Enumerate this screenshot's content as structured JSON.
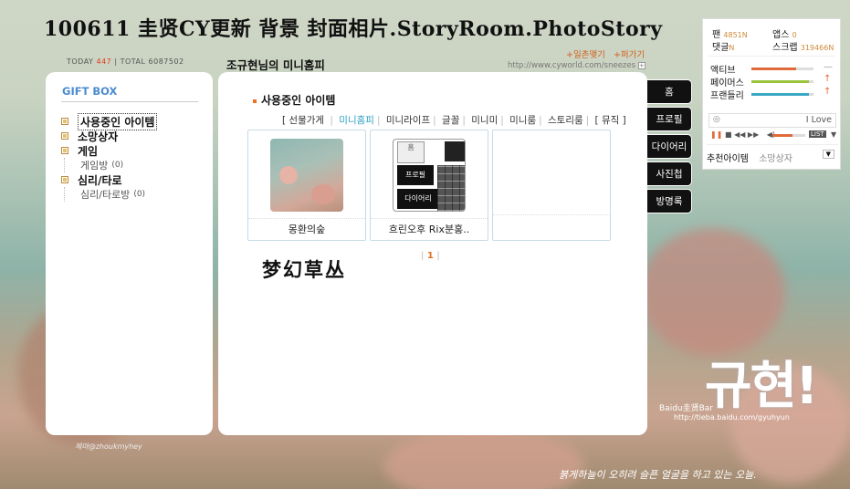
{
  "banner_title": "100611 圭贤CY更新 背景 封面相片.StoryRoom.PhotoStory",
  "counter": {
    "today_label": "TODAY",
    "today_value": "447",
    "sep": "|",
    "total_label": "TOTAL",
    "total_value": "6087502"
  },
  "homepage_title": "조규현님의 미니홈피",
  "top_links": [
    "+일촌맺기",
    "+퍼가기"
  ],
  "url_text": "http://www.cyworld.com/sneezes",
  "url_plus": "+",
  "left": {
    "giftbox_title": "GIFT BOX",
    "tree": [
      {
        "label": "사용중인 아이템",
        "selected": true,
        "children": []
      },
      {
        "label": "소망상자",
        "children": []
      },
      {
        "label": "게임",
        "children": [
          {
            "label": "게임방",
            "count": "(0)"
          }
        ]
      },
      {
        "label": "심리/타로",
        "children": [
          {
            "label": "심리/타로방",
            "count": "(0)"
          }
        ]
      }
    ]
  },
  "main": {
    "section_title": "사용중인 아이템",
    "categories": [
      "[ 선물가게",
      "미니홈피",
      "미니라이프",
      "글꼴",
      "미니미",
      "미니룸",
      "스토리룸",
      "[ 뮤직 ]"
    ],
    "active_category": "미니홈피",
    "items": [
      {
        "name": "몽환의숲"
      },
      {
        "name": "흐린오후 Rix분홍.."
      },
      {
        "name": ""
      }
    ],
    "item2_tabs": [
      "홈",
      "프로필",
      "다이어리"
    ],
    "page_current": "1",
    "page_bracket": "|",
    "handwriting": "梦幻草丛"
  },
  "nav_tabs": [
    "홈",
    "프로필",
    "다이어리",
    "사진첩",
    "방명록"
  ],
  "sidebar": {
    "fan_label": "팬",
    "fan_value": "4851",
    "fan_badge": "N",
    "apps_label": "앱스",
    "apps_value": "0",
    "comment_label": "댓글",
    "comment_badge": "N",
    "scrap_label": "스크랩",
    "scrap_value": "319466",
    "scrap_badge": "N",
    "stats": [
      {
        "label": "액티브",
        "level": 0.72,
        "color": "#e06a3a",
        "indicator": "—"
      },
      {
        "label": "페이머스",
        "level": 0.92,
        "color": "#9ac43a",
        "indicator": "↑"
      },
      {
        "label": "프랜들리",
        "level": 0.92,
        "color": "#3aa8c4",
        "indicator": "↑"
      }
    ],
    "player_text": "I Love",
    "player_list": "LIST",
    "rec_tab": "추천아이템",
    "rec_tab2": "소망상자",
    "rec_arrow": "▼"
  },
  "signature": "규현!",
  "signature_sub": "Baidu圭贤Bar",
  "signature_url": "http://tieba.baidu.com/gyuhyun",
  "watermark": "체마@zhoukmyhey",
  "bottom_text": "붉게하늘이 오히려 슬픈 얼굴을 하고 있는 오늘."
}
